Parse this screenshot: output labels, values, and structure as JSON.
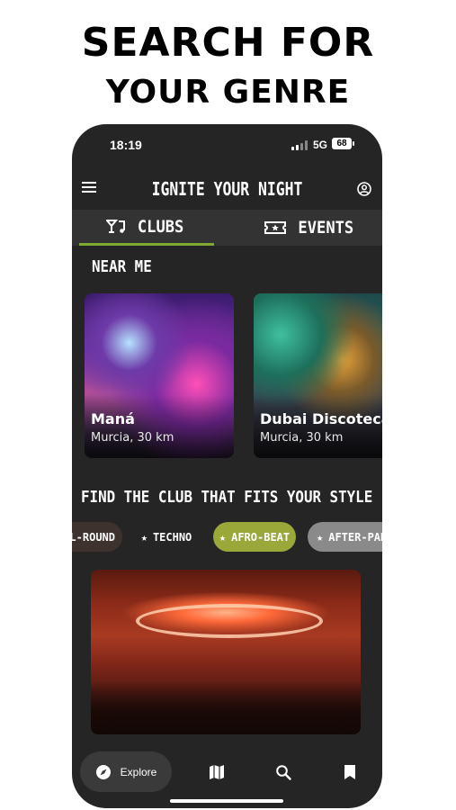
{
  "headline": {
    "line1": "SEARCH FOR",
    "line2": "YOUR GENRE"
  },
  "status_bar": {
    "time": "18:19",
    "network": "5G",
    "battery": "68"
  },
  "header": {
    "title": "IGNITE YOUR NIGHT"
  },
  "tabs": [
    {
      "label": "CLUBS",
      "icon": "cocktail-music-icon",
      "active": true
    },
    {
      "label": "EVENTS",
      "icon": "ticket-icon",
      "active": false
    }
  ],
  "near_me": {
    "title": "NEAR ME",
    "clubs": [
      {
        "name": "Maná",
        "location": "Murcia, 30 km"
      },
      {
        "name": "Dubai Discoteca",
        "location": "Murcia, 30 km"
      }
    ]
  },
  "style_section": {
    "title": "FIND THE CLUB THAT FITS YOUR STYLE",
    "chips": [
      {
        "label": "ALL-ROUND",
        "selected": false
      },
      {
        "label": "TECHNO",
        "selected": false
      },
      {
        "label": "AFRO-BEAT",
        "selected": true
      },
      {
        "label": "AFTER-PARTY",
        "selected": false
      }
    ]
  },
  "bottom_nav": {
    "explore_label": "Explore",
    "items": [
      "compass-icon",
      "map-icon",
      "search-icon",
      "bookmark-icon"
    ]
  },
  "colors": {
    "accent": "#9aa83a",
    "tab_underline": "#7fa835",
    "background": "#252525"
  }
}
